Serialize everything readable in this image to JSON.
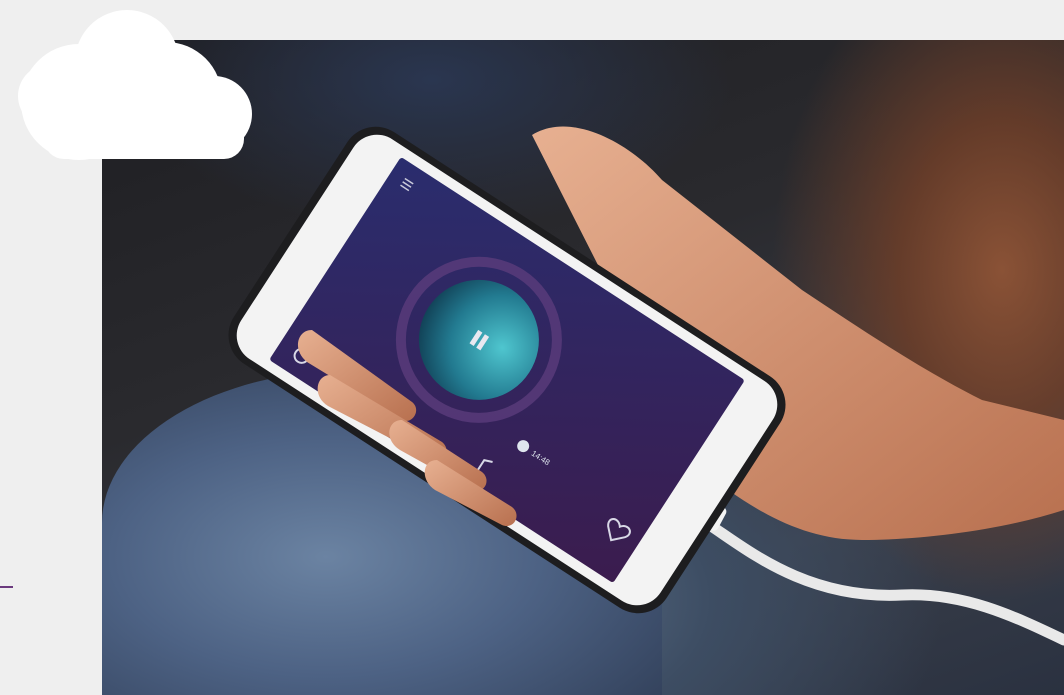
{
  "player": {
    "timer_text": "14:48",
    "screen_colors": {
      "top": "#2a2d6e",
      "bottom": "#3b1c4e",
      "disc_highlight": "#4fc6cf",
      "disc_shadow": "#0c2f44"
    }
  },
  "icons": {
    "menu": "menu-icon",
    "play": "play-icon",
    "timer": "timer-icon",
    "favorite": "heart-icon",
    "playlist": "music-note-icon",
    "history": "clock-icon"
  },
  "colors": {
    "background": "#efefef",
    "accent": "#6b3a7e",
    "cloud": "#ffffff"
  }
}
